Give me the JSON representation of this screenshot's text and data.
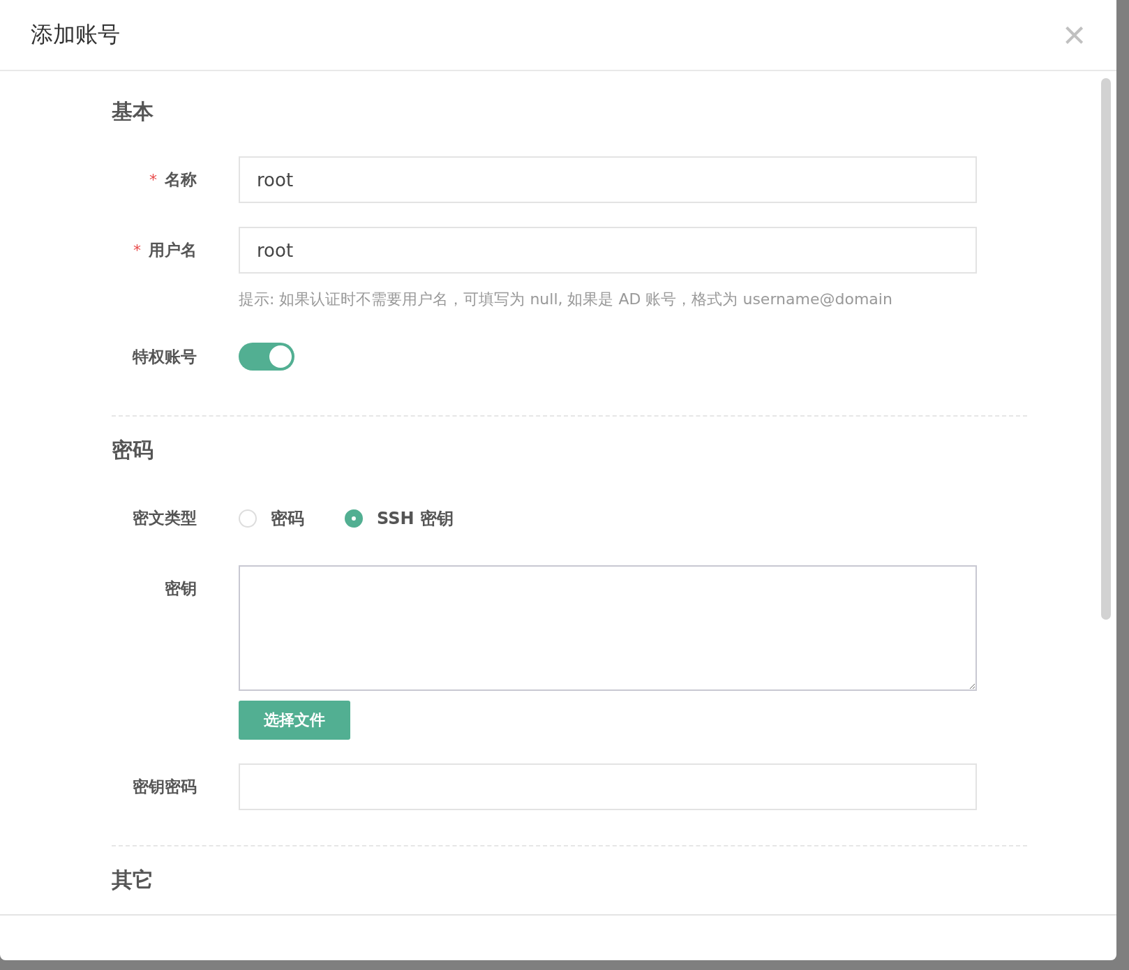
{
  "dialog": {
    "title": "添加账号",
    "close": "×"
  },
  "sections": [
    {
      "title": "基本",
      "fields": [
        {
          "kind": "input",
          "label": "名称",
          "required_mark": "*",
          "value": "root"
        },
        {
          "kind": "input",
          "label": "用户名",
          "required_mark": "*",
          "value": "root",
          "hint": "提示: 如果认证时不需要用户名，可填写为 null, 如果是 AD 账号，格式为 username@domain"
        },
        {
          "kind": "switch",
          "label": "特权账号",
          "on": true
        }
      ]
    },
    {
      "title": "密码",
      "fields": [
        {
          "kind": "radio",
          "label": "密文类型",
          "options": [
            {
              "label": "密码",
              "selected": false
            },
            {
              "label": "SSH 密钥",
              "selected": true
            }
          ]
        },
        {
          "kind": "textarea",
          "label": "密钥",
          "button": "选择文件"
        },
        {
          "kind": "input",
          "label": "密钥密码"
        }
      ]
    },
    {
      "title": "其它"
    }
  ]
}
